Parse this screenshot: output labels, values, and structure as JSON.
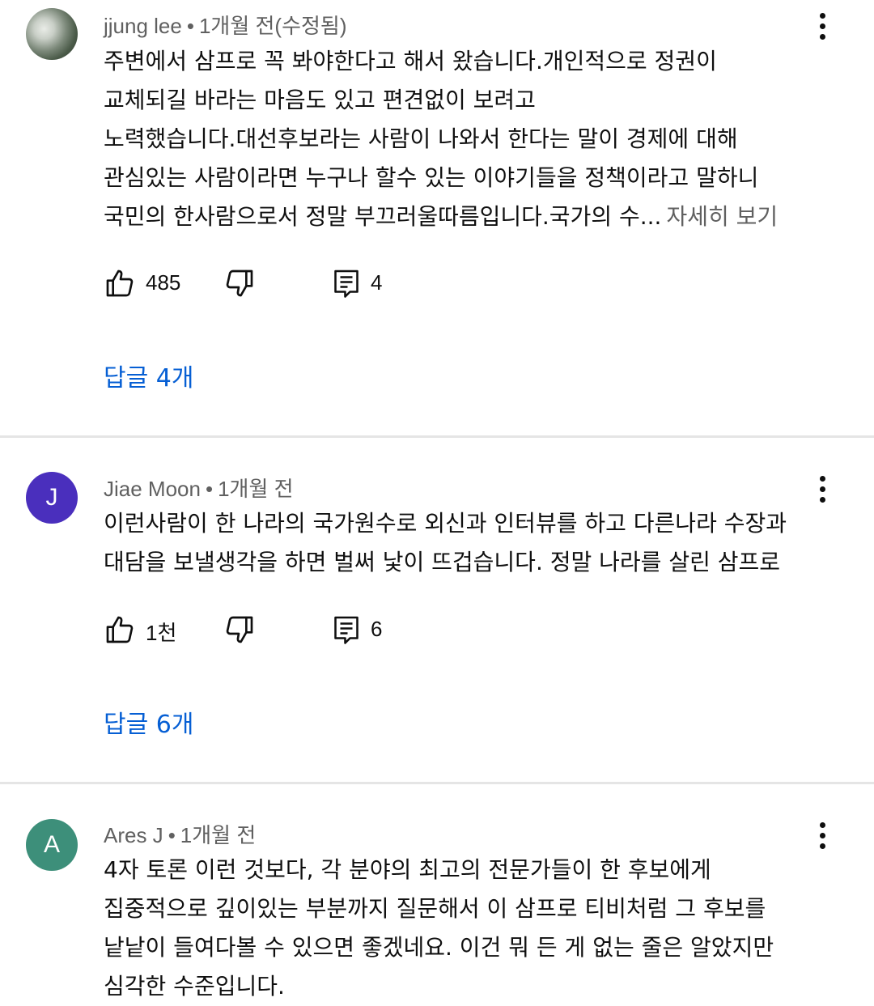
{
  "comments": [
    {
      "author": "jjung lee",
      "time": "1개월 전(수정됨)",
      "text": "주변에서 삼프로 꼭 봐야한다고 해서 왔습니다.개인적으로 정권이\n교체되길 바라는 마음도 있고 편견없이 보려고\n노력했습니다.대선후보라는 사람이 나와서 한다는 말이 경제에 대해\n관심있는 사람이라면 누구나 할수 있는 이야기들을 정책이라고 말하니\n국민의 한사람으로서 정말 부끄러울따름입니다.국가의 수...",
      "more_label": "자세히 보기",
      "likes": "485",
      "reply_count": "4",
      "replies_label": "답글 4개"
    },
    {
      "author": "Jiae Moon",
      "avatar_letter": "J",
      "avatar_color": "#4a2fbd",
      "time": "1개월 전",
      "text": "이런사람이 한 나라의 국가원수로 외신과 인터뷰를 하고 다른나라 수장과\n대담을 보낼생각을 하면 벌써 낯이 뜨겁습니다. 정말 나라를 살린 삼프로",
      "likes": "1천",
      "reply_count": "6",
      "replies_label": "답글 6개"
    },
    {
      "author": "Ares J",
      "avatar_letter": "A",
      "avatar_color": "#3d8f7a",
      "time": "1개월 전",
      "text": "4자 토론 이런 것보다, 각 분야의 최고의 전문가들이 한 후보에게\n집중적으로 깊이있는 부분까지 질문해서 이 삼프로 티비처럼 그 후보를\n낱낱이 들여다볼 수 있으면 좋겠네요. 이건 뭐 든 게 없는 줄은 알았지만\n심각한 수준입니다."
    }
  ],
  "meta_separator": "•",
  "icons": {
    "like": "thumb-up-icon",
    "dislike": "thumb-down-icon",
    "reply": "comment-icon",
    "menu": "more-vert-icon"
  }
}
